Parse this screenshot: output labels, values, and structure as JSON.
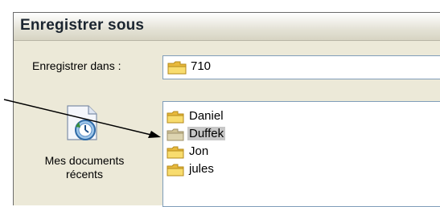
{
  "dialog": {
    "title": "Enregistrer sous"
  },
  "save_in": {
    "label": "Enregistrer dans :",
    "value": "710"
  },
  "places": [
    {
      "label_line1": "Mes documents",
      "label_line2": "récents",
      "icon": "recent-documents-icon"
    }
  ],
  "files": [
    {
      "name": "Daniel",
      "selected": false
    },
    {
      "name": "Duffek",
      "selected": true
    },
    {
      "name": "Jon",
      "selected": false
    },
    {
      "name": "jules",
      "selected": false
    }
  ],
  "colors": {
    "folder": "#f5d86a",
    "selected_folder": "#d8cfa8",
    "selection_bg": "#c7c7c7"
  }
}
